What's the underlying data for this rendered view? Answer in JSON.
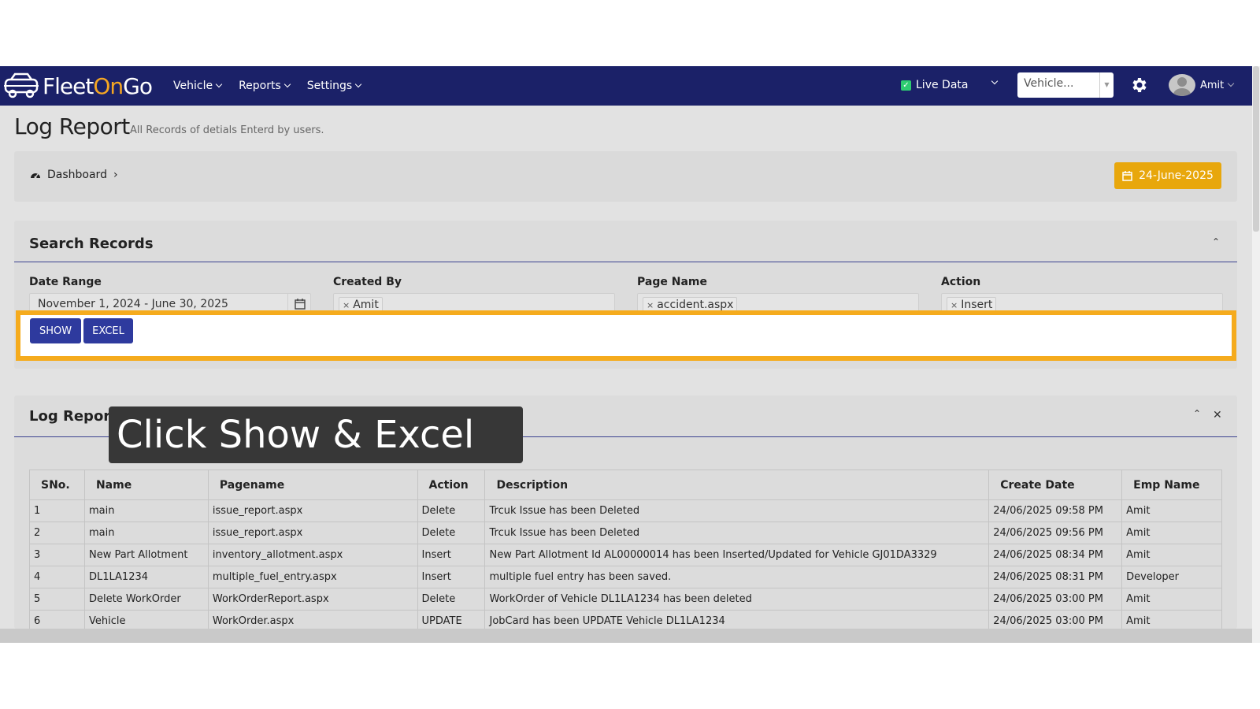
{
  "app": {
    "logo_word1": "Fleet",
    "logo_word2": "On",
    "logo_word3": "Go",
    "brand_color": "#1b2168",
    "accent_color": "#f5a623"
  },
  "nav": {
    "items": [
      {
        "label": "Vehicle"
      },
      {
        "label": "Reports"
      },
      {
        "label": "Settings"
      }
    ],
    "live_data_label": "Live Data",
    "vehicle_placeholder": "Vehicle...",
    "user_name": "Amit"
  },
  "page": {
    "title": "Log Report",
    "subtitle": "All Records of detials Enterd by users.",
    "breadcrumb": "Dashboard",
    "date_badge": "24-June-2025"
  },
  "search": {
    "title": "Search Records",
    "date_range_label": "Date Range",
    "date_range_value": "November 1, 2024 - June 30, 2025",
    "created_by_label": "Created By",
    "created_by_value": "Amit",
    "page_name_label": "Page Name",
    "page_name_value": "accident.aspx",
    "action_label": "Action",
    "action_value": "Insert",
    "show_label": "SHOW",
    "excel_label": "EXCEL"
  },
  "tooltip": {
    "text": "Click Show & Excel"
  },
  "log": {
    "title": "Log Report",
    "columns": [
      "SNo.",
      "Name",
      "Pagename",
      "Action",
      "Description",
      "Create Date",
      "Emp Name"
    ],
    "rows": [
      [
        "1",
        "main",
        "issue_report.aspx",
        "Delete",
        "Trcuk Issue has been Deleted",
        "24/06/2025 09:58 PM",
        "Amit"
      ],
      [
        "2",
        "main",
        "issue_report.aspx",
        "Delete",
        "Trcuk Issue has been Deleted",
        "24/06/2025 09:56 PM",
        "Amit"
      ],
      [
        "3",
        "New Part Allotment",
        "inventory_allotment.aspx",
        "Insert",
        "New Part Allotment Id AL00000014 has been Inserted/Updated for Vehicle GJ01DA3329",
        "24/06/2025 08:34 PM",
        "Amit"
      ],
      [
        "4",
        "DL1LA1234",
        "multiple_fuel_entry.aspx",
        "Insert",
        "multiple fuel entry has been saved.",
        "24/06/2025 08:31 PM",
        "Developer"
      ],
      [
        "5",
        "Delete WorkOrder",
        "WorkOrderReport.aspx",
        "Delete",
        "WorkOrder of Vehicle DL1LA1234 has been deleted",
        "24/06/2025 03:00 PM",
        "Amit"
      ],
      [
        "6",
        "Vehicle",
        "WorkOrder.aspx",
        "UPDATE",
        "JobCard has been UPDATE Vehicle DL1LA1234",
        "24/06/2025 03:00 PM",
        "Amit"
      ]
    ]
  }
}
